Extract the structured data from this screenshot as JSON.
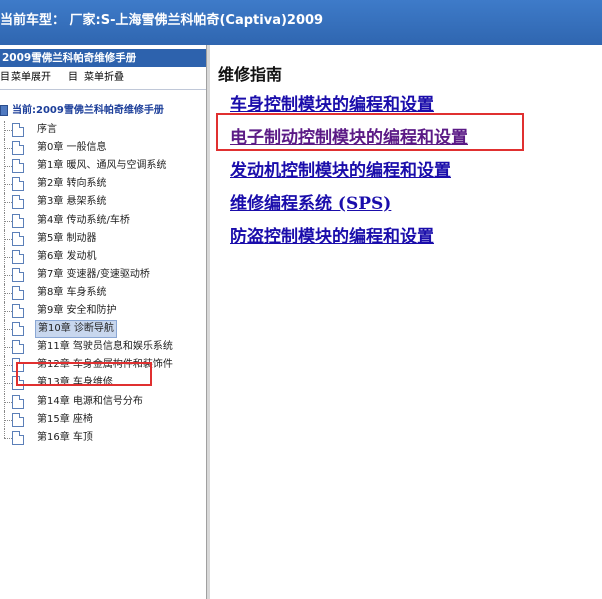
{
  "header": {
    "title": "当前车型： 厂家:S-上海雪佛兰科帕奇(Captiva)2009",
    "dot": "."
  },
  "sidebar": {
    "title": "2009雪佛兰科帕奇维修手册",
    "expand_label": "菜单展开",
    "collapse_label": "菜单折叠",
    "root_label": "当前:2009雪佛兰科帕奇维修手册",
    "items": [
      {
        "label": "序言"
      },
      {
        "label": "第0章 一般信息"
      },
      {
        "label": "第1章 暖风、通风与空调系统"
      },
      {
        "label": "第2章 转向系统"
      },
      {
        "label": "第3章 悬架系统"
      },
      {
        "label": "第4章 传动系统/车桥"
      },
      {
        "label": "第5章 制动器"
      },
      {
        "label": "第6章 发动机"
      },
      {
        "label": "第7章 变速器/变速驱动桥"
      },
      {
        "label": "第8章 车身系统"
      },
      {
        "label": "第9章 安全和防护"
      },
      {
        "label": "第10章 诊断导航"
      },
      {
        "label": "第11章 驾驶员信息和娱乐系统"
      },
      {
        "label": "第12章 车身金属构件和装饰件"
      },
      {
        "label": "第13章 车身维修"
      },
      {
        "label": "第14章 电源和信号分布"
      },
      {
        "label": "第15章 座椅"
      },
      {
        "label": "第16章 车顶"
      }
    ],
    "selected_index": 11
  },
  "main": {
    "title": "维修指南",
    "links": [
      {
        "label": "车身控制模块的编程和设置"
      },
      {
        "label": "电子制动控制模块的编程和设置"
      },
      {
        "label": "发动机控制模块的编程和设置"
      },
      {
        "label": "维修编程系统 (SPS)"
      },
      {
        "label": "防盗控制模块的编程和设置"
      }
    ]
  },
  "colors": {
    "header_bg": "#2f66b0",
    "link": "#1a0dab",
    "visited_link": "#5b1a86",
    "highlight_box": "#e03030",
    "selected_bg": "#c8d7ee"
  }
}
